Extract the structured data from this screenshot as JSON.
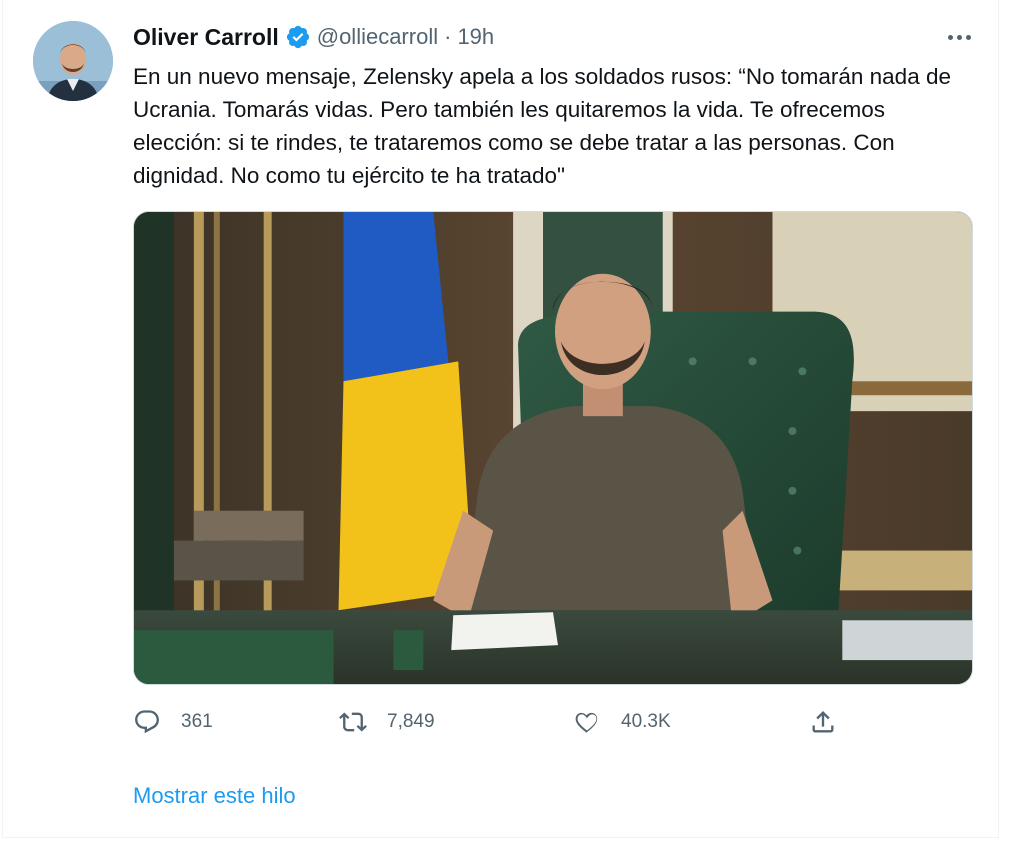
{
  "author": {
    "name": "Oliver Carroll",
    "handle": "@olliecarroll",
    "separator": "·",
    "time": "19h",
    "verified_icon": "verified-badge-icon",
    "verified_color": "#1d9bf0"
  },
  "tweet": {
    "text": "En un nuevo mensaje, Zelensky apela a los soldados rusos: “No tomarán nada de Ucrania. Tomarás vidas. Pero también les quitaremos la vida. Te ofrecemos elección: si te rindes, te trataremos como se debe tratar a las personas. Con dignidad. No como tu ejército te ha tratado\""
  },
  "media": {
    "kind": "photo",
    "subject": "man in olive t-shirt seated at desk in front of Ukrainian flag"
  },
  "actions": {
    "reply": {
      "icon": "reply-icon",
      "count": "361"
    },
    "retweet": {
      "icon": "retweet-icon",
      "count": "7,849"
    },
    "like": {
      "icon": "heart-icon",
      "count": "40.3K"
    },
    "share": {
      "icon": "share-icon"
    }
  },
  "footer": {
    "show_thread": "Mostrar este hilo"
  },
  "colors": {
    "text": "#0f1419",
    "secondary": "#536471",
    "link": "#1d9bf0"
  }
}
